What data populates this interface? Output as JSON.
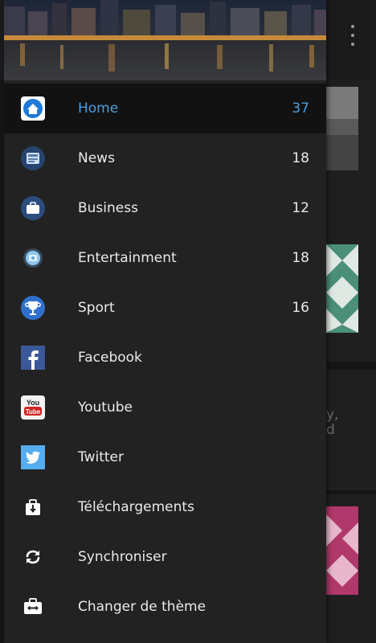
{
  "drawer": {
    "items": [
      {
        "label": "Home",
        "count": "37",
        "icon": "home-icon",
        "active": true
      },
      {
        "label": "News",
        "count": "18",
        "icon": "news-icon"
      },
      {
        "label": "Business",
        "count": "12",
        "icon": "briefcase-icon"
      },
      {
        "label": "Entertainment",
        "count": "18",
        "icon": "entertainment-icon"
      },
      {
        "label": "Sport",
        "count": "16",
        "icon": "trophy-icon"
      },
      {
        "label": "Facebook",
        "count": "",
        "icon": "facebook-icon"
      },
      {
        "label": "Youtube",
        "count": "",
        "icon": "youtube-icon"
      },
      {
        "label": "Twitter",
        "count": "",
        "icon": "twitter-icon"
      },
      {
        "label": "Téléchargements",
        "count": "",
        "icon": "download-icon"
      },
      {
        "label": "Synchroniser",
        "count": "",
        "icon": "sync-icon"
      },
      {
        "label": "Changer de thème",
        "count": "",
        "icon": "change-theme-icon"
      }
    ]
  },
  "icons": {
    "youtube_line1": "You",
    "youtube_line2": "Tube"
  },
  "background": {
    "snippet_line1": "y,",
    "snippet_line2": "d"
  },
  "colors": {
    "accent": "#4a9fdf",
    "drawer_bg": "#222222",
    "active_bg": "#121212",
    "text": "#eaeaea"
  }
}
